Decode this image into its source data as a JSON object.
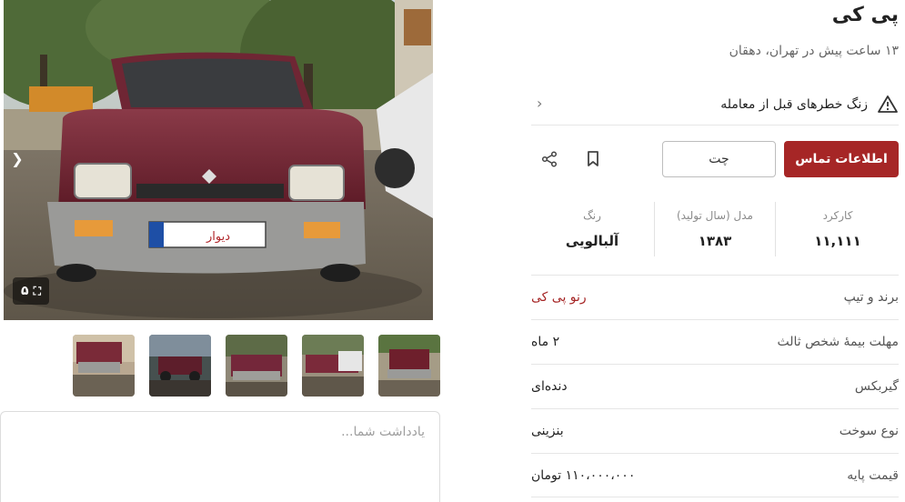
{
  "gallery": {
    "photo_count": "۵",
    "thumbnails_count_note": "five thumbnails"
  },
  "note": {
    "placeholder": "یادداشت شما..."
  },
  "ad": {
    "title": "پی کی",
    "subtitle": "۱۳ ساعت پیش در تهران، دهقان",
    "warning": "زنگ خطرهای قبل از معامله"
  },
  "actions": {
    "contact_label": "اطلاعات تماس",
    "chat_label": "چت"
  },
  "stats": {
    "km_label": "کارکرد",
    "km_value": "۱۱,۱۱۱",
    "model_label": "مدل (سال تولید)",
    "model_value": "۱۳۸۳",
    "color_label": "رنگ",
    "color_value": "آلبالویی"
  },
  "rows": [
    {
      "key": "برند و تیپ",
      "value": "رنو پی کی"
    },
    {
      "key": "مهلت بیمهٔ شخص ثالث",
      "value": "۲ ماه"
    },
    {
      "key": "گیربکس",
      "value": "دنده‌ای"
    },
    {
      "key": "نوع سوخت",
      "value": "بنزینی"
    },
    {
      "key": "قیمت پایه",
      "value": "۱۱۰،۰۰۰،۰۰۰ تومان"
    }
  ],
  "photo_plate_text": "دیوار",
  "colors": {
    "accent": "#a62626",
    "car_body": "#6e1f2c"
  },
  "icons": {
    "warning": "warning-triangle-icon",
    "chevron": "chevron-left-icon",
    "bookmark": "bookmark-icon",
    "share": "share-icon",
    "expand": "expand-icon",
    "arrow": "arrow-right-icon"
  }
}
